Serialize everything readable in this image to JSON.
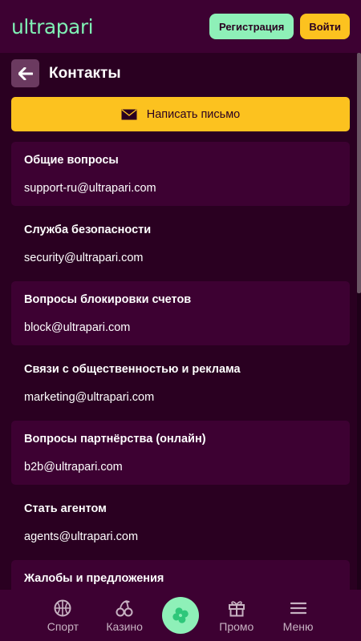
{
  "header": {
    "logo": "ultrapari",
    "register_label": "Регистрация",
    "login_label": "Войти"
  },
  "page": {
    "title": "Контакты",
    "write_button_label": "Написать письмо"
  },
  "contacts": [
    {
      "title": "Общие вопросы",
      "email": "support-ru@ultrapari.com"
    },
    {
      "title": "Служба безопасности",
      "email": "security@ultrapari.com"
    },
    {
      "title": "Вопросы блокировки счетов",
      "email": "block@ultrapari.com"
    },
    {
      "title": "Связи с общественностью и реклама",
      "email": "marketing@ultrapari.com"
    },
    {
      "title": "Вопросы партнёрства (онлайн)",
      "email": "b2b@ultrapari.com"
    },
    {
      "title": "Стать агентом",
      "email": "agents@ultrapari.com"
    },
    {
      "title": "Жалобы и предложения",
      "email": ""
    }
  ],
  "bottom_nav": {
    "sport": "Спорт",
    "casino": "Казино",
    "promo": "Промо",
    "menu": "Меню"
  },
  "colors": {
    "background": "#2a0021",
    "panel": "#3d0132",
    "accent_yellow": "#fcc21f",
    "accent_green": "#8ef0b8"
  }
}
